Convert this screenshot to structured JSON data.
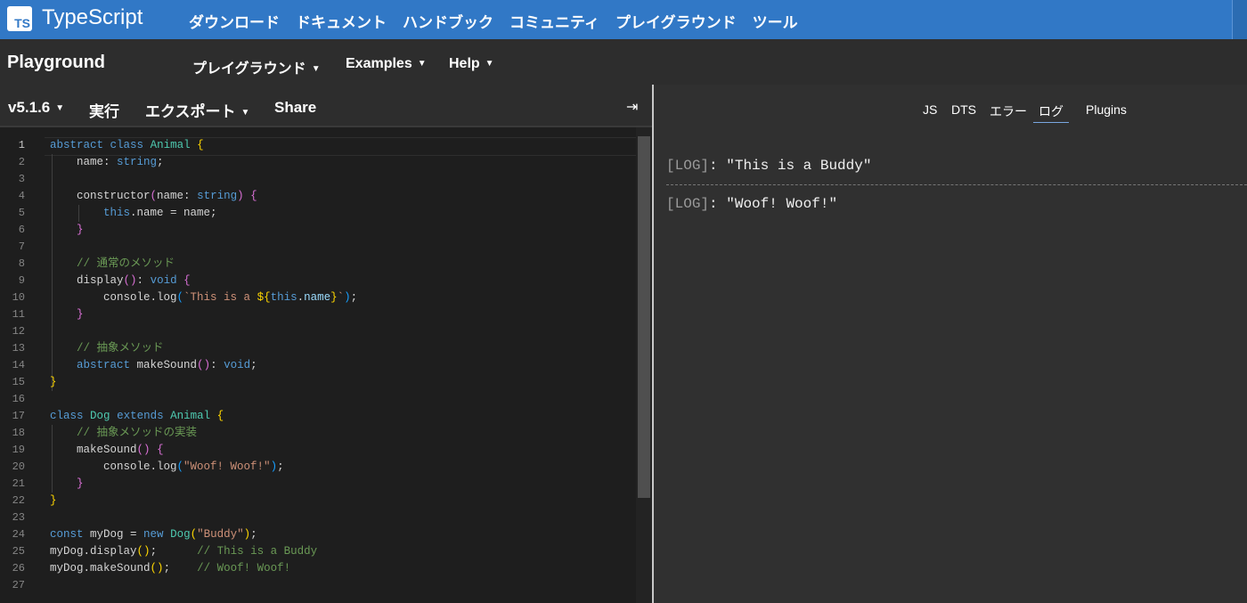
{
  "header": {
    "logo_text": "TS",
    "brand": "TypeScript",
    "nav": [
      "ダウンロード",
      "ドキュメント",
      "ハンドブック",
      "コミュニティ",
      "プレイグラウンド",
      "ツール"
    ]
  },
  "subheader": {
    "title": "Playground",
    "menus": [
      "プレイグラウンド",
      "Examples",
      "Help"
    ]
  },
  "toolbar": {
    "version": "v5.1.6",
    "run": "実行",
    "export": "エクスポート",
    "share": "Share",
    "collapse_icon": "⇥"
  },
  "editor": {
    "current_line": 1,
    "lines": [
      "abstract class Animal {",
      "    name: string;",
      "",
      "    constructor(name: string) {",
      "        this.name = name;",
      "    }",
      "",
      "    // 通常のメソッド",
      "    display(): void {",
      "        console.log(`This is a ${this.name}`);",
      "    }",
      "",
      "    // 抽象メソッド",
      "    abstract makeSound(): void;",
      "}",
      "",
      "class Dog extends Animal {",
      "    // 抽象メソッドの実装",
      "    makeSound() {",
      "        console.log(\"Woof! Woof!\");",
      "    }",
      "}",
      "",
      "const myDog = new Dog(\"Buddy\");",
      "myDog.display();      // This is a Buddy",
      "myDog.makeSound();    // Woof! Woof!",
      ""
    ]
  },
  "output": {
    "tabs": [
      "JS",
      "DTS",
      "エラー",
      "ログ",
      "Plugins"
    ],
    "active_tab": "ログ",
    "logs": [
      {
        "tag": "LOG",
        "message": "\"This is a Buddy\""
      },
      {
        "tag": "LOG",
        "message": "\"Woof! Woof!\""
      }
    ]
  }
}
